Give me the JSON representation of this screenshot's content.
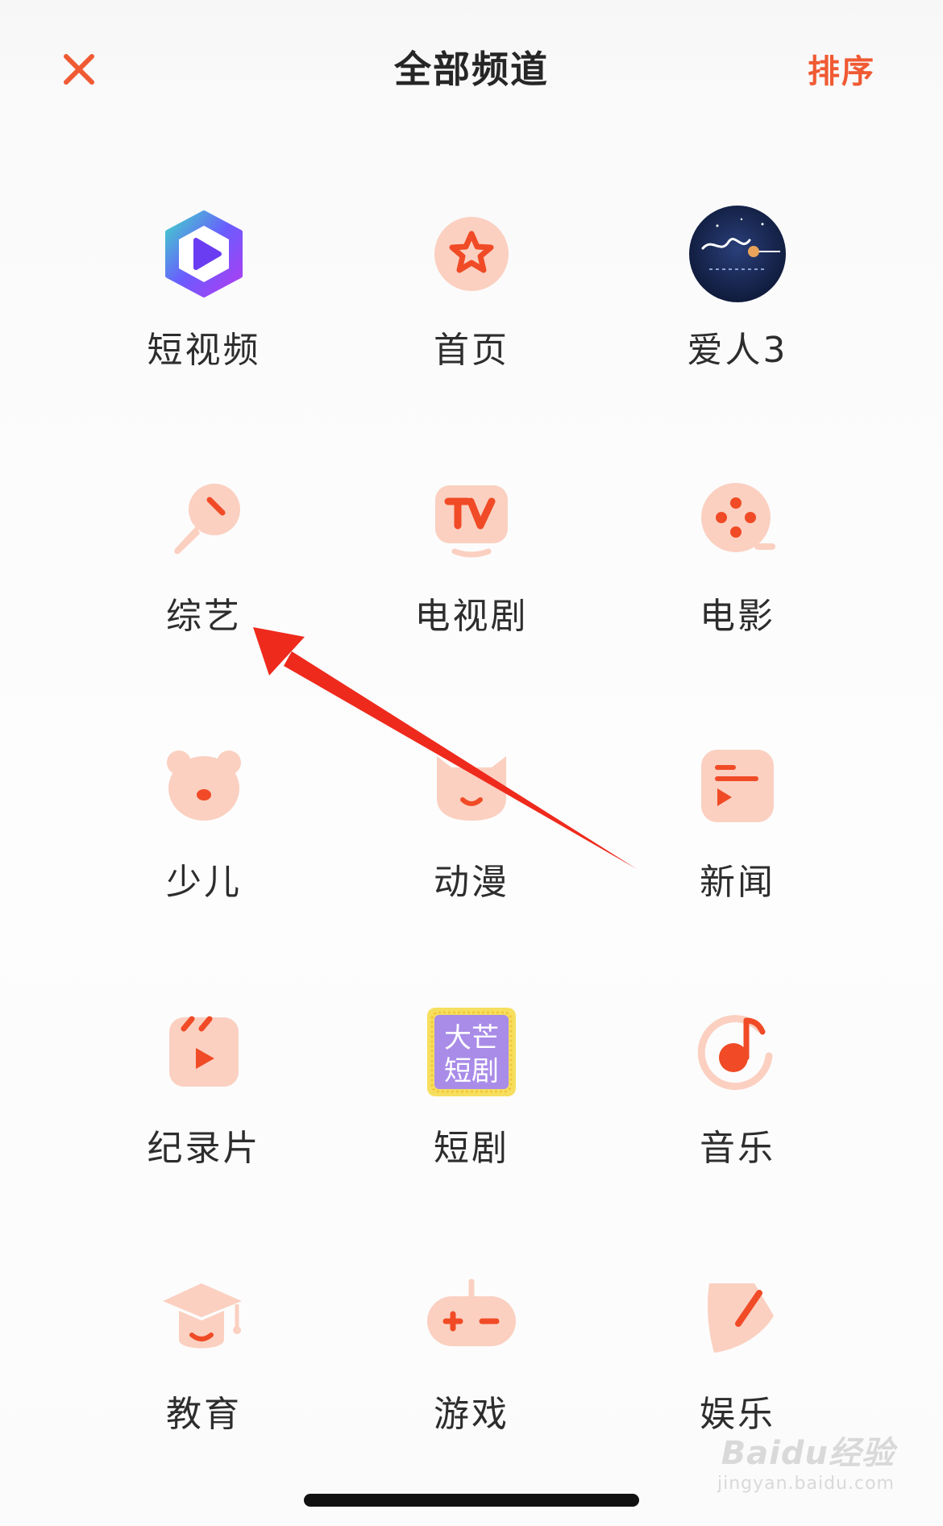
{
  "header": {
    "title": "全部频道",
    "sort_label": "排序",
    "close_icon": "close-icon"
  },
  "colors": {
    "accent": "#f05a33",
    "icon_bg": "#fbd0c1",
    "icon_mark": "#f04b26"
  },
  "channels": [
    {
      "label": "短视频",
      "icon": "short-video-icon"
    },
    {
      "label": "首页",
      "icon": "star-icon"
    },
    {
      "label": "爱人3",
      "icon": "drama-poster-icon"
    },
    {
      "label": "综艺",
      "icon": "microphone-icon"
    },
    {
      "label": "电视剧",
      "icon": "tv-icon"
    },
    {
      "label": "电影",
      "icon": "film-reel-icon"
    },
    {
      "label": "少儿",
      "icon": "bear-icon"
    },
    {
      "label": "动漫",
      "icon": "cat-face-icon"
    },
    {
      "label": "新闻",
      "icon": "news-icon"
    },
    {
      "label": "纪录片",
      "icon": "clapper-icon"
    },
    {
      "label": "短剧",
      "icon": "mango-short-drama-icon",
      "badge_line1": "大芒",
      "badge_line2": "短剧"
    },
    {
      "label": "音乐",
      "icon": "music-note-icon"
    },
    {
      "label": "教育",
      "icon": "graduation-cap-icon"
    },
    {
      "label": "游戏",
      "icon": "gamepad-icon"
    },
    {
      "label": "娱乐",
      "icon": "leaf-icon"
    }
  ],
  "watermark": {
    "brand": "Baidu经验",
    "url": "jingyan.baidu.com"
  }
}
